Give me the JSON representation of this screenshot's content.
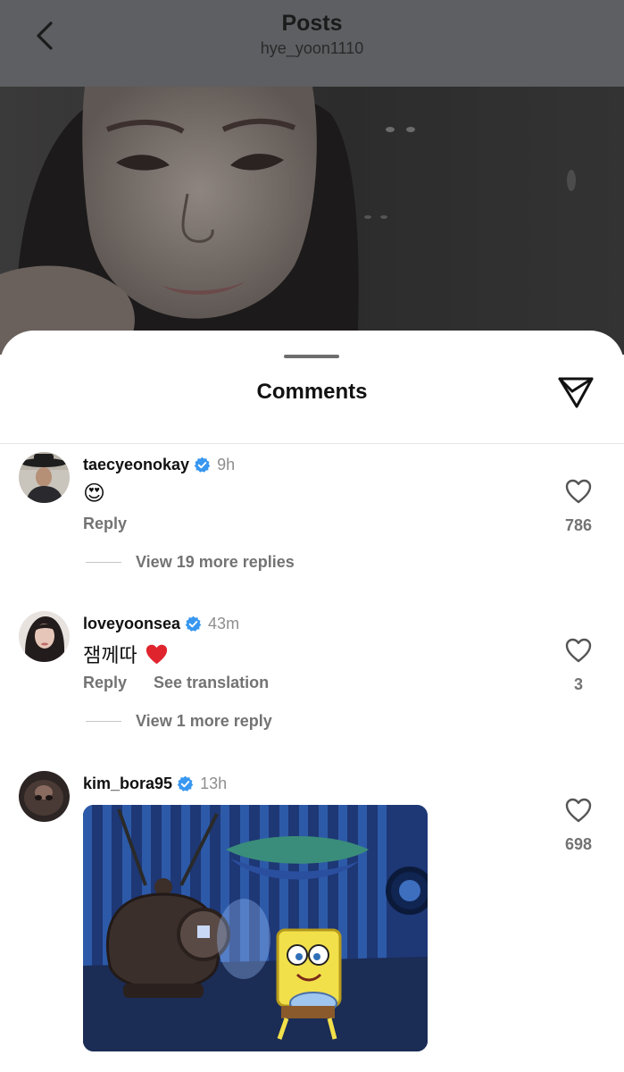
{
  "header": {
    "title": "Posts",
    "username": "hye_yoon1110"
  },
  "sheet": {
    "title": "Comments"
  },
  "comments": [
    {
      "username": "taecyeonokay",
      "verified": true,
      "time": "9h",
      "text": "😍",
      "actions": [
        "Reply"
      ],
      "more_replies": "View 19 more replies",
      "likes": "786"
    },
    {
      "username": "loveyoonsea",
      "verified": true,
      "time": "43m",
      "text": "잼께따",
      "text_emoji": "❤️",
      "actions": [
        "Reply",
        "See translation"
      ],
      "more_replies": "View 1 more reply",
      "likes": "3"
    },
    {
      "username": "kim_bora95",
      "verified": true,
      "time": "13h",
      "attachment": "gif",
      "likes": "698"
    }
  ],
  "colors": {
    "verified": "#3897f0",
    "secondary_text": "#737373",
    "overlay": "#5d5f62"
  },
  "icons": [
    "back-chevron-icon",
    "share-send-icon",
    "verified-badge-icon",
    "heart-outline-icon"
  ]
}
